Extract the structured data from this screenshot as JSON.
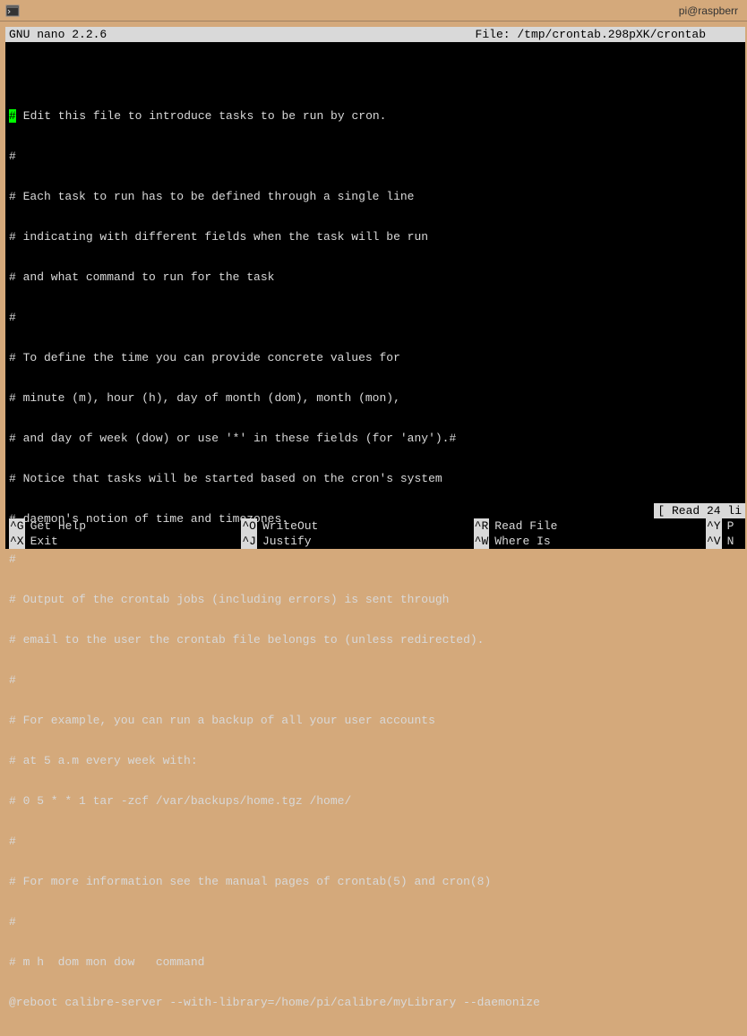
{
  "window": {
    "title": "pi@raspberr"
  },
  "header": {
    "app": " GNU nano 2.2.6",
    "file": "File: /tmp/crontab.298pXK/crontab"
  },
  "lines": {
    "l0_first": "#",
    "l0_rest": " Edit this file to introduce tasks to be run by cron.",
    "l1": "# ",
    "l2": "# Each task to run has to be defined through a single line",
    "l3": "# indicating with different fields when the task will be run",
    "l4": "# and what command to run for the task",
    "l5": "# ",
    "l6": "# To define the time you can provide concrete values for",
    "l7": "# minute (m), hour (h), day of month (dom), month (mon),",
    "l8": "# and day of week (dow) or use '*' in these fields (for 'any').# ",
    "l9": "# Notice that tasks will be started based on the cron's system",
    "l10": "# daemon's notion of time and timezones.",
    "l11": "# ",
    "l12": "# Output of the crontab jobs (including errors) is sent through",
    "l13": "# email to the user the crontab file belongs to (unless redirected).",
    "l14": "# ",
    "l15": "# For example, you can run a backup of all your user accounts",
    "l16": "# at 5 a.m every week with:",
    "l17": "# 0 5 * * 1 tar -zcf /var/backups/home.tgz /home/",
    "l18": "# ",
    "l19": "# For more information see the manual pages of crontab(5) and cron(8)",
    "l20": "# ",
    "l21": "# m h  dom mon dow   command",
    "l22": "@reboot calibre-server --with-library=/home/pi/calibre/myLibrary --daemonize"
  },
  "status": "[ Read 24 li",
  "menu": {
    "row1": [
      {
        "key": "^G",
        "label": "Get Help"
      },
      {
        "key": "^O",
        "label": "WriteOut"
      },
      {
        "key": "^R",
        "label": "Read File"
      },
      {
        "key": "^Y",
        "label": "P"
      }
    ],
    "row2": [
      {
        "key": "^X",
        "label": "Exit"
      },
      {
        "key": "^J",
        "label": "Justify"
      },
      {
        "key": "^W",
        "label": "Where Is"
      },
      {
        "key": "^V",
        "label": "N"
      }
    ]
  }
}
